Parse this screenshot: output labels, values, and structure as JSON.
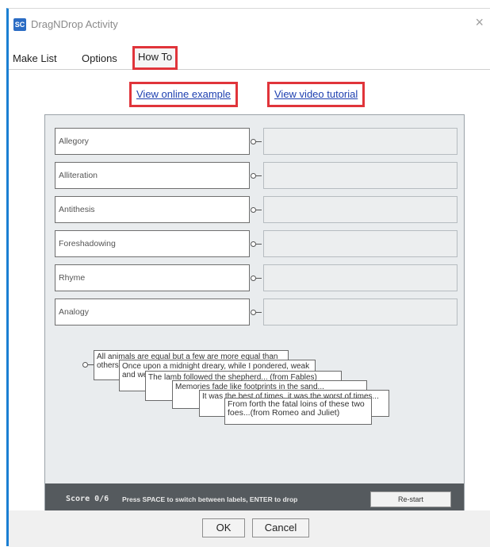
{
  "window": {
    "title": "DragNDrop Activity",
    "app_icon": "SC",
    "close": "×"
  },
  "tabs": [
    {
      "label": "Make List"
    },
    {
      "label": "Options"
    },
    {
      "label": "How To"
    }
  ],
  "links": {
    "online_example": "View online example",
    "video_tutorial": "View video tutorial"
  },
  "terms": [
    "Allegory",
    "Alliteration",
    "Antithesis",
    "Foreshadowing",
    "Rhyme",
    "Analogy"
  ],
  "cards": [
    "All animals are equal but a few are more equal than others... (from Animal Farm)",
    "Once upon a midnight dreary, while I pondered, weak and weary... (from The Raven)",
    "The lamb followed the shepherd... (from Fables)",
    "Memories fade like footprints in the sand...",
    "It was the best of times, it was the worst of times...",
    "From forth the fatal loins of these two foes...(from Romeo and Juliet)"
  ],
  "footer": {
    "score": "Score 0/6",
    "hint": "Press SPACE to switch between labels, ENTER to drop",
    "restart": "Re-start"
  },
  "buttons": {
    "ok": "OK",
    "cancel": "Cancel"
  },
  "colors": {
    "highlight": "#e0343a",
    "link": "#1d3fb0",
    "accent": "#1a7fd3",
    "footer_bg": "#555a5e"
  }
}
